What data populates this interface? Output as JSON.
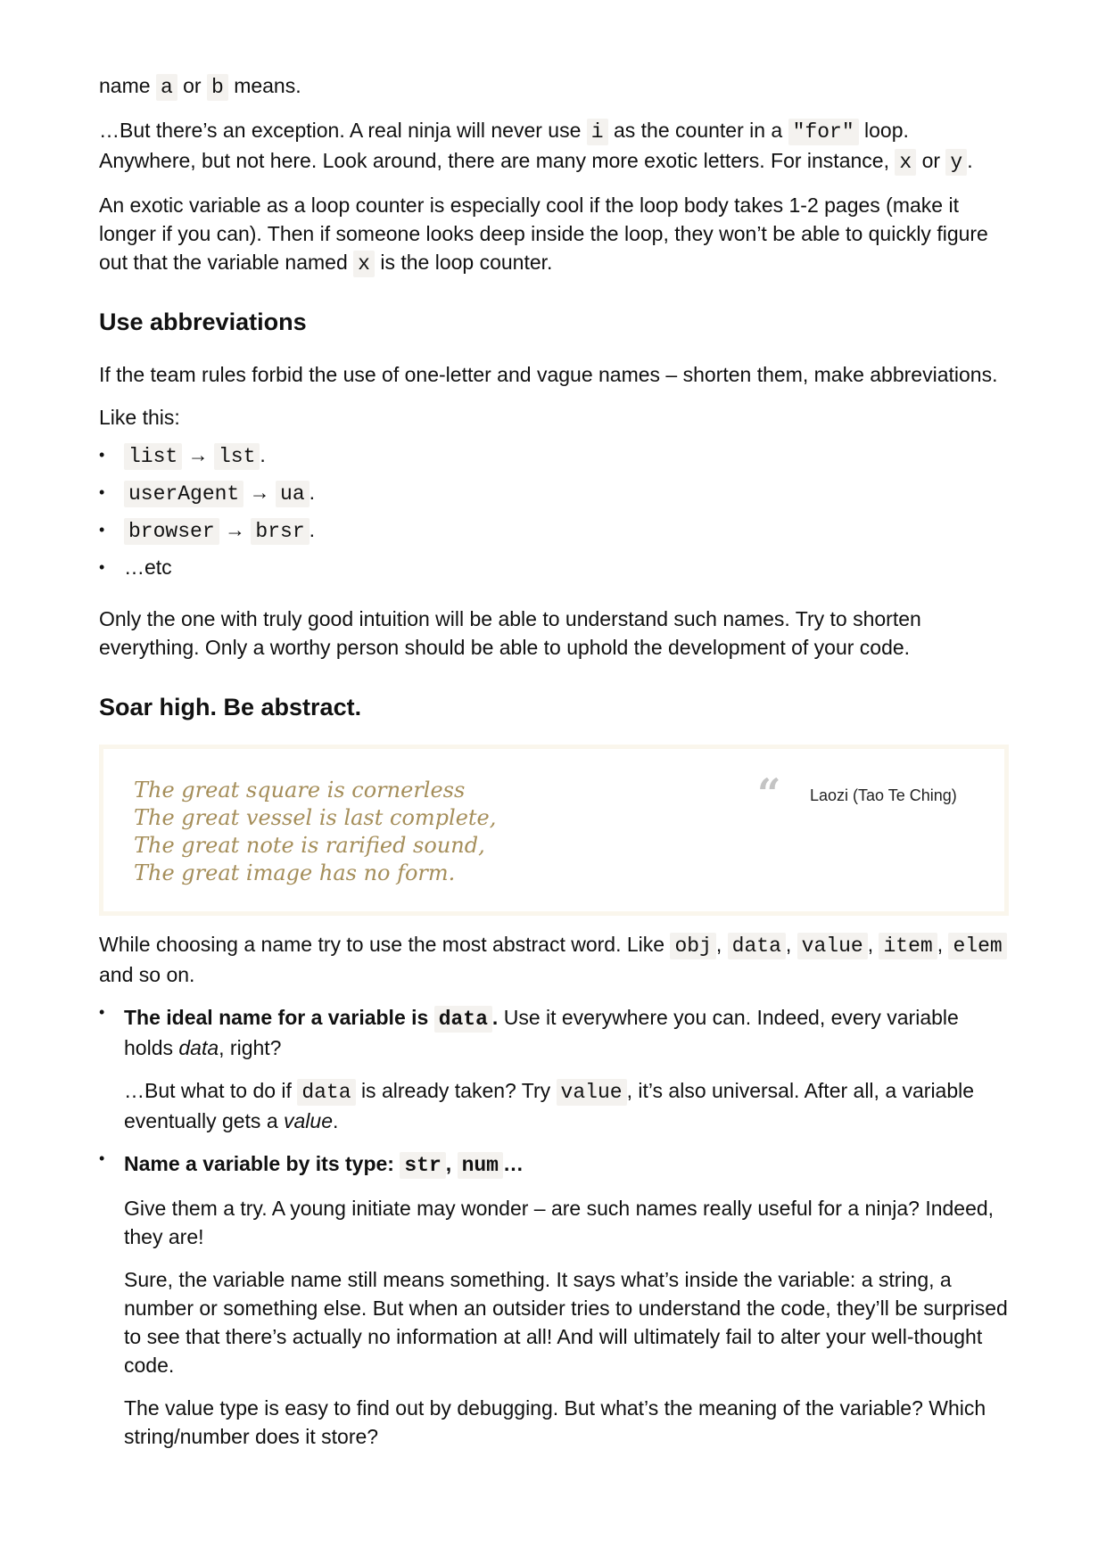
{
  "intro": {
    "p1": {
      "pre": "name",
      "a": "a",
      "or": "or",
      "b": "b",
      "post": "means."
    },
    "p2": {
      "t1": "…But there’s an exception. A real ninja will never use",
      "i": "i",
      "t2": "as the counter in a",
      "for": "\"for\"",
      "t3": "loop. Anywhere, but not here. Look around, there are many more exotic letters. For instance,",
      "x": "x",
      "or": "or",
      "y": "y",
      "end": "."
    },
    "p3": {
      "t1": "An exotic variable as a loop counter is especially cool if the loop body takes 1-2 pages (make it longer if you can). Then if someone looks deep inside the loop, they won’t be able to quickly figure out that the variable named",
      "x": "x",
      "t2": "is the loop counter."
    }
  },
  "abbr": {
    "heading": "Use abbreviations",
    "p1": "If the team rules forbid the use of one-letter and vague names – shorten them, make abbreviations.",
    "p2": "Like this:",
    "arrow": "→",
    "items": [
      {
        "from": "list",
        "to": "lst",
        "end": "."
      },
      {
        "from": "userAgent",
        "to": "ua",
        "end": "."
      },
      {
        "from": "browser",
        "to": "brsr",
        "end": "."
      }
    ],
    "etc": "…etc",
    "p3": "Only the one with truly good intuition will be able to understand such names. Try to shorten everything. Only a worthy person should be able to uphold the development of your code."
  },
  "abstract": {
    "heading": "Soar high. Be abstract.",
    "quote": {
      "lines": [
        "The great square is cornerless",
        "The great vessel is last complete,",
        "The great note is rarified sound,",
        "The great image has no form."
      ],
      "mark": "“",
      "author": "Laozi (Tao Te Ching)"
    },
    "p1": {
      "t1": "While choosing a name try to use the most abstract word. Like",
      "obj": "obj",
      "data": "data",
      "value": "value",
      "item": "item",
      "elem": "elem",
      "comma": ",",
      "t2": "and so on."
    },
    "b1": {
      "bold_pre": "The ideal name for a variable is",
      "bold_code": "data",
      "bold_end": ".",
      "t1": "Use it everywhere you can. Indeed, every variable holds",
      "em": "data",
      "t2": ", right?",
      "p2_t1": "…But what to do if",
      "p2_code1": "data",
      "p2_t2": "is already taken? Try",
      "p2_code2": "value",
      "p2_t3": ", it’s also universal. After all, a variable eventually gets a",
      "p2_em": "value",
      "p2_end": "."
    },
    "b2": {
      "bold_pre": "Name a variable by its type:",
      "code1": "str",
      "comma": ",",
      "code2": "num",
      "bold_end": "…",
      "p1": "Give them a try. A young initiate may wonder – are such names really useful for a ninja? Indeed, they are!",
      "p2": "Sure, the variable name still means something. It says what’s inside the variable: a string, a number or something else. But when an outsider tries to understand the code, they’ll be surprised to see that there’s actually no information at all! And will ultimately fail to alter your well-thought code.",
      "p3": "The value type is easy to find out by debugging. But what’s the meaning of the variable? Which string/number does it store?"
    }
  }
}
